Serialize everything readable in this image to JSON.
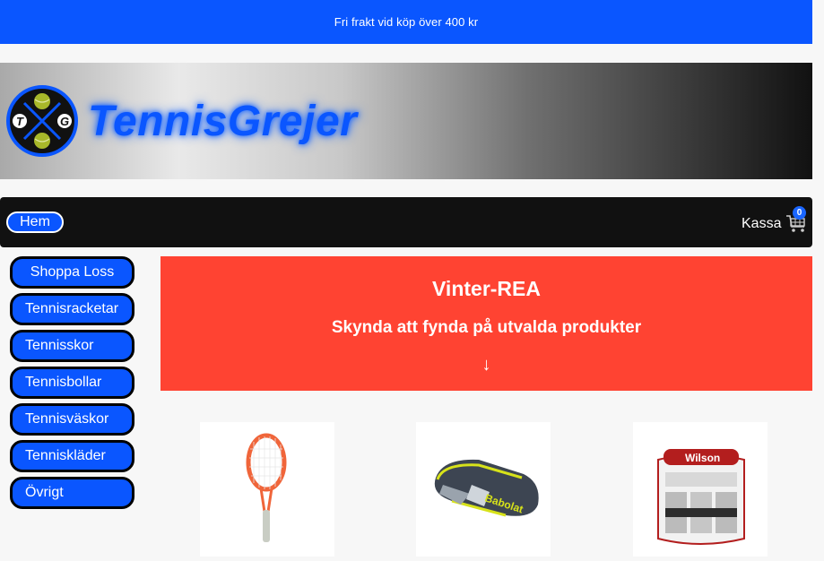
{
  "topbar": {
    "text": "Fri frakt vid köp över 400 kr"
  },
  "header": {
    "brand": "TennisGrejer",
    "logo_letters": [
      "T",
      "G"
    ]
  },
  "nav": {
    "home_label": "Hem",
    "checkout_label": "Kassa",
    "cart_count": "0"
  },
  "sidebar": {
    "items": [
      {
        "label": "Shoppa Loss"
      },
      {
        "label": "Tennisracketar"
      },
      {
        "label": "Tennisskor"
      },
      {
        "label": "Tennisbollar"
      },
      {
        "label": "Tennisväskor"
      },
      {
        "label": "Tenniskläder"
      },
      {
        "label": "Övrigt"
      }
    ]
  },
  "promo": {
    "title": "Vinter-REA",
    "subtitle": "Skynda att fynda på utvalda produkter",
    "arrow": "↓"
  },
  "products": {
    "bag_brand": "Babolat",
    "grip_brand": "Wilson"
  },
  "colors": {
    "brand_blue": "#0a56ff",
    "promo_red": "#ff4332",
    "nav_black": "#111111",
    "racket_orange": "#f0653a"
  }
}
